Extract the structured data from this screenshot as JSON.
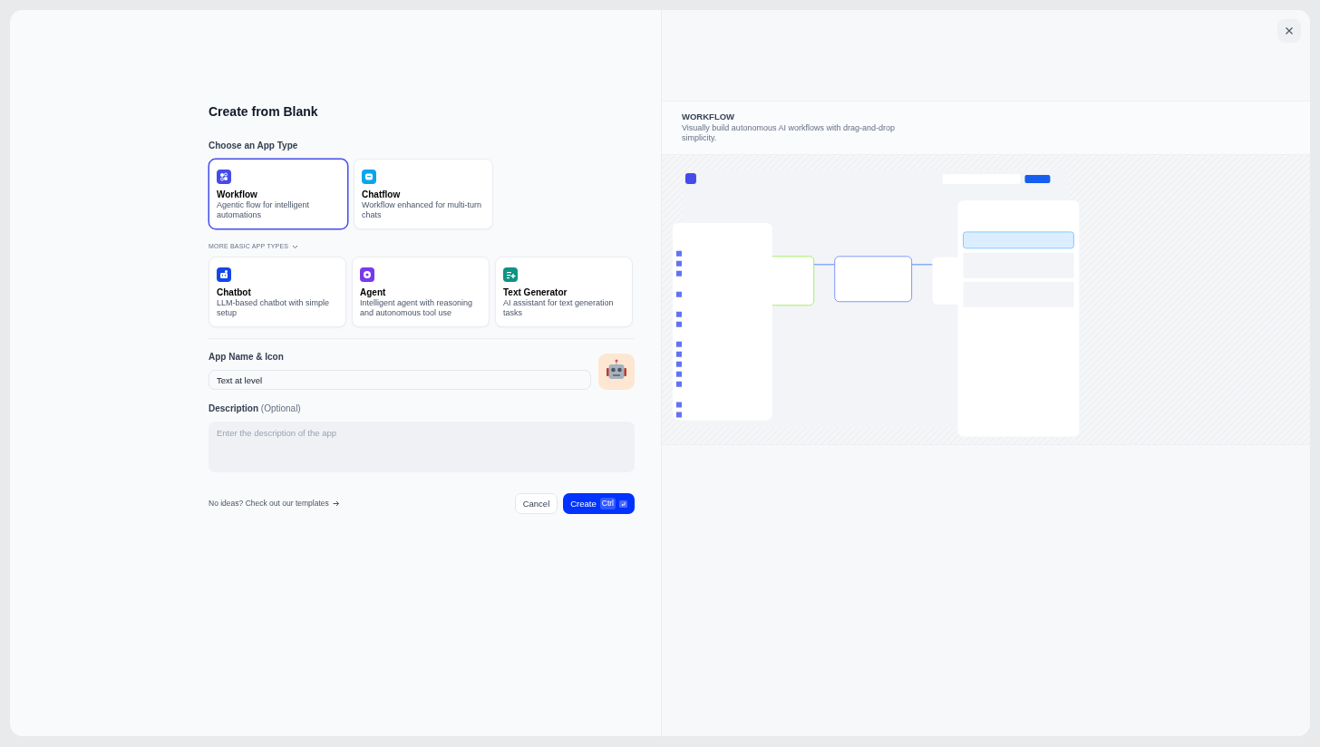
{
  "title": "Create from Blank",
  "app_type_label": "Choose an App Type",
  "primary_types": [
    {
      "kind": "workflow",
      "color": "#444ce7",
      "title": "Workflow",
      "description": "Agentic flow for intelligent automations",
      "selected": true
    },
    {
      "kind": "chatflow",
      "color": "#0ba5ec",
      "title": "Chatflow",
      "description": "Workflow enhanced for multi-turn chats",
      "selected": false
    }
  ],
  "more_toggle": {
    "label": "MORE BASIC APP TYPES",
    "expanded": true
  },
  "basic_types": [
    {
      "kind": "chatbot",
      "color": "#1447e6",
      "title": "Chatbot",
      "description": "LLM-based chatbot with simple setup",
      "selected": false
    },
    {
      "kind": "agent",
      "color": "#7839ee",
      "title": "Agent",
      "description": "Intelligent agent with reasoning and autonomous tool use",
      "selected": false
    },
    {
      "kind": "generator",
      "color": "#0e9384",
      "title": "Text Generator",
      "description": "AI assistant for text generation tasks",
      "selected": false
    }
  ],
  "name_field": {
    "label": "App Name & Icon",
    "value": "Text at level"
  },
  "description_field": {
    "label": "Description",
    "hint": "(Optional)",
    "placeholder": "Enter the description of the app"
  },
  "templates_link": "No ideas? Check out our templates",
  "cancel_button": "Cancel",
  "create_button": {
    "label": "Create",
    "shortcut": "Ctrl"
  },
  "preview": {
    "title": "WORKFLOW",
    "description": "Visually build autonomous AI workflows with drag-and-drop simplicity."
  }
}
